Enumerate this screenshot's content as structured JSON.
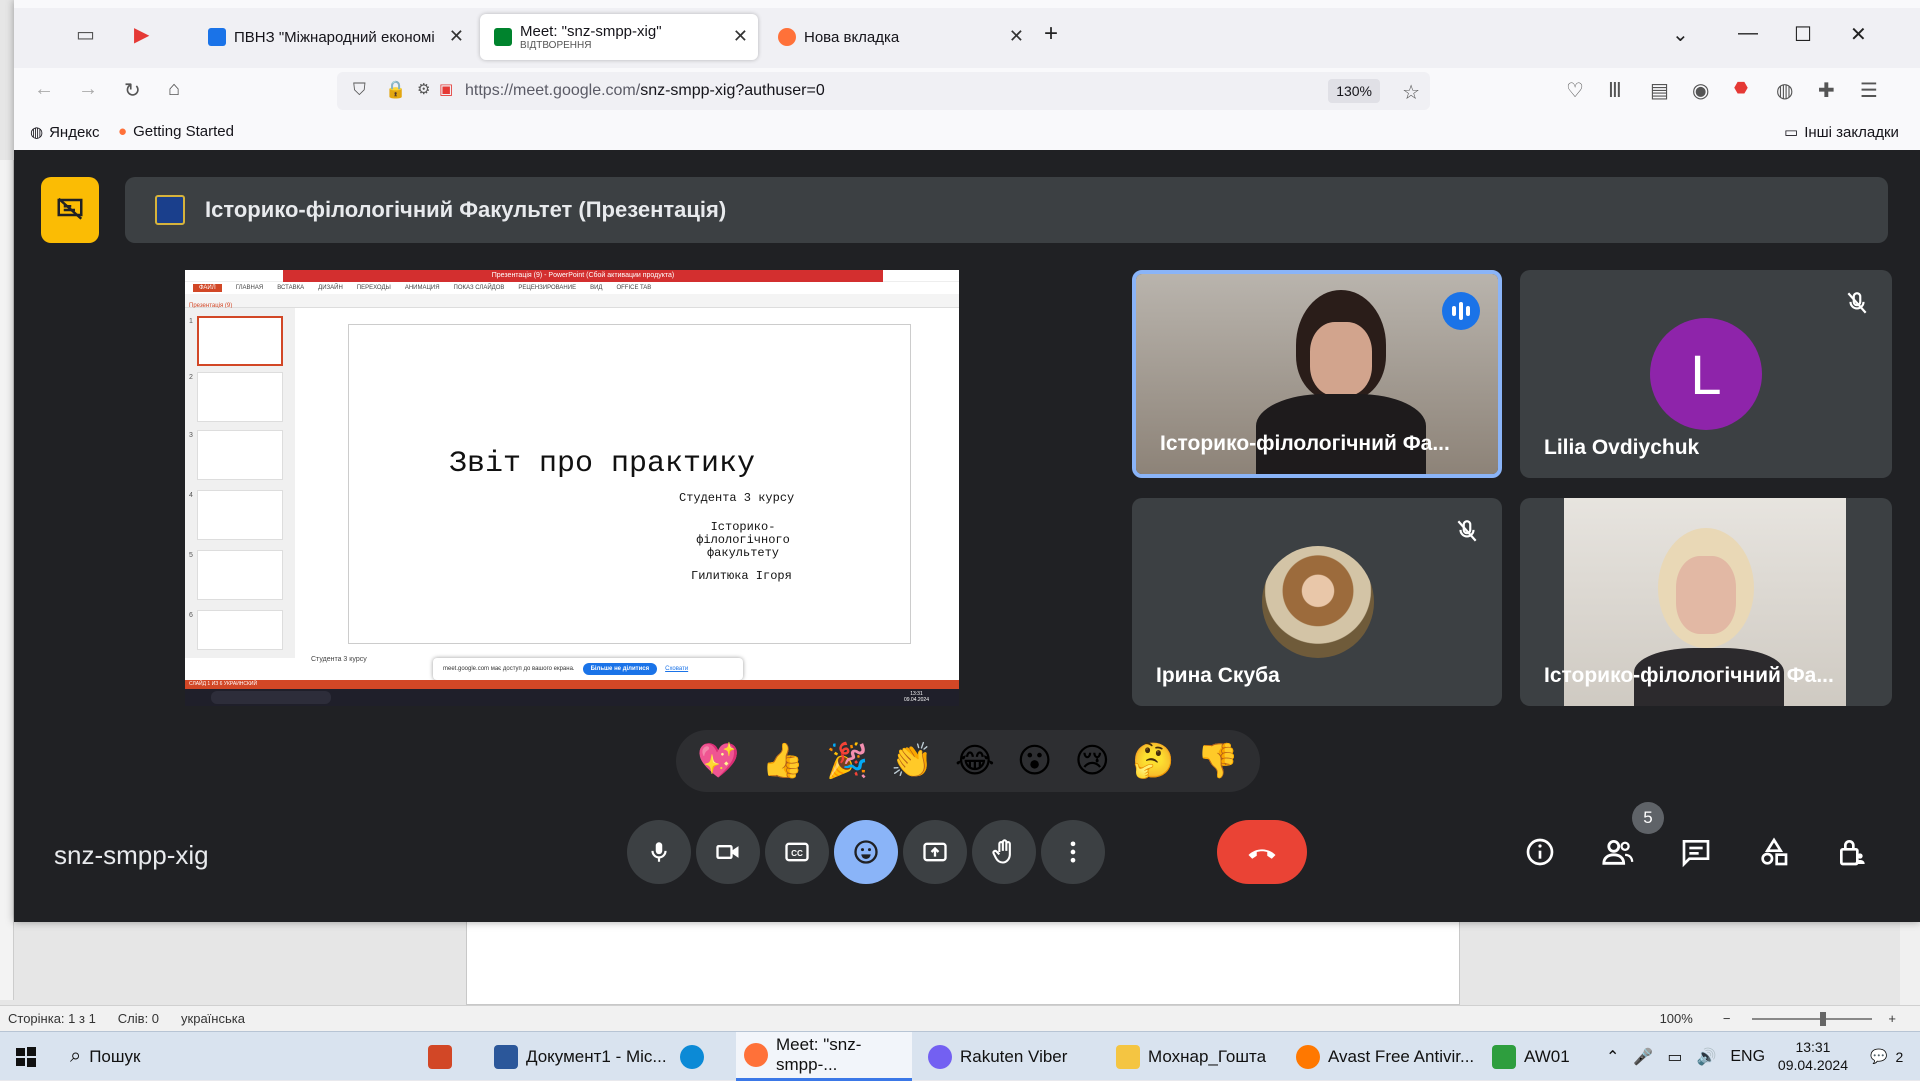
{
  "browser": {
    "tabs": [
      {
        "label": "ПВНЗ \"Міжнародний економі",
        "favicon_color": "#1a73e8"
      },
      {
        "label": "Meet: \"snz-smpp-xig\"",
        "sublabel": "ВІДТВОРЕННЯ",
        "active": true,
        "favicon_color": "#00832d"
      },
      {
        "label": "Нова вкладка",
        "favicon_color": "#ff7139"
      }
    ],
    "new_tab": "+",
    "url_host": "https://meet.google.com/",
    "url_path": "snz-smpp-xig?authuser=0",
    "zoom": "130%",
    "bookmarks": [
      {
        "label": "Яндекс"
      },
      {
        "label": "Getting Started"
      }
    ],
    "other_bookmarks": "Інші закладки"
  },
  "meet": {
    "presentation_title": "Історико-філологічний Факультет (Презентація)",
    "meeting_code": "snz-smpp-xig",
    "participant_count": "5",
    "shared_screen": {
      "app_title": "Презентація (9) - PowerPoint (Сбой активации продукта)",
      "ribbon": [
        "ФАЙЛ",
        "ГЛАВНАЯ",
        "ВСТАВКА",
        "ДИЗАЙН",
        "ПЕРЕХОДЫ",
        "АНИМАЦИЯ",
        "ПОКАЗ СЛАЙДОВ",
        "РЕЦЕНЗИРОВАНИЕ",
        "ВИД",
        "OFFICE TAB"
      ],
      "doc_tab": "Презентація (9)",
      "slide_title": "Звіт про практику",
      "slide_line1": "Студента 3 курсу",
      "slide_line2": "Історико-філологічного факультету",
      "slide_line3": "Гилитюка Ігоря",
      "notes": "Студента 3 курсу",
      "popup_text": "meet.google.com має доступ до вашого екрана.",
      "popup_button": "Більше не ділитися",
      "popup_hide": "Сховати",
      "status": "СЛАЙД 1 ИЗ 6    УКРАИНСКИЙ",
      "clock_time": "13:31",
      "clock_date": "09.04.2024",
      "thumb_numbers": [
        "1",
        "2",
        "3",
        "4",
        "5",
        "6"
      ]
    },
    "participants": [
      {
        "name": "Історико-філологічний Фа...",
        "speaking": true
      },
      {
        "name": "Lilia Ovdiychuk",
        "initial": "L",
        "muted": true,
        "avatar_color": "#8e24aa"
      },
      {
        "name": "Ірина Скуба",
        "muted": true
      },
      {
        "name": "Історико-філологічний Фа..."
      }
    ],
    "reactions": [
      "💖",
      "👍",
      "🎉",
      "👏",
      "😂",
      "😮",
      "😢",
      "🤔",
      "👎"
    ]
  },
  "word": {
    "status_page": "Сторінка: 1 з 1",
    "status_words": "Слів: 0",
    "status_lang": "українська",
    "zoom": "100%"
  },
  "taskbar": {
    "search": "Пошук",
    "items": [
      {
        "label": "Документ1 - Mic..."
      },
      {
        "label": "Meet: \"snz-smpp-...",
        "active": true
      },
      {
        "label": "Rakuten Viber"
      },
      {
        "label": "Мохнар_Гошта"
      },
      {
        "label": "Avast Free Antivir..."
      },
      {
        "label": "AW01"
      }
    ],
    "lang": "ENG",
    "time": "13:31",
    "date": "09.04.2024",
    "notifications": "2"
  }
}
